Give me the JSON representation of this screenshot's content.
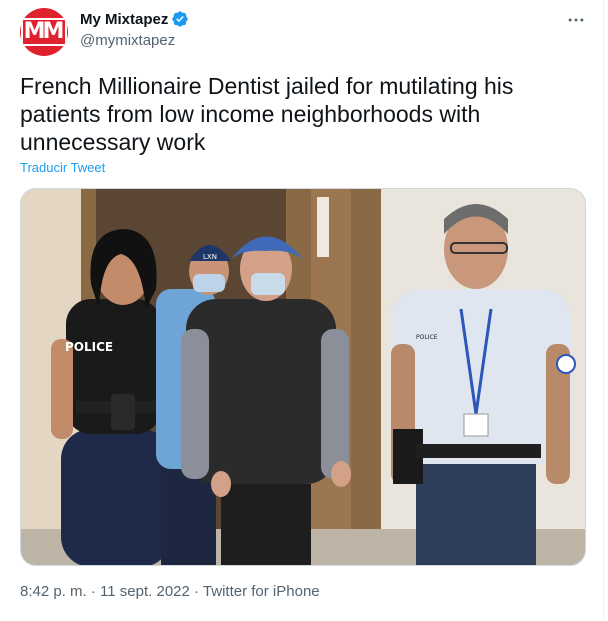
{
  "tweet": {
    "display_name": "My Mixtapez",
    "handle": "@mymixtapez",
    "avatar_text": "MM",
    "verified_icon": "verified-badge-icon",
    "more_icon": "more-horizontal-icon",
    "text": "French Millionaire Dentist jailed for mutilating his patients from low income neighborhoods with unnecessary work",
    "translate_label": "Traducir Tweet",
    "photo": {
      "police_shirt_text": "POLICE",
      "cap_text": "LXN",
      "officer_badge_text": "POLICE"
    },
    "time": "8:42 p. m.",
    "date": "11 sept. 2022",
    "source": "Twitter for iPhone",
    "separator": "·"
  },
  "colors": {
    "accent": "#1d9bf0",
    "brand": "#e0212e",
    "text_primary": "#0f1419",
    "text_secondary": "#536471"
  }
}
